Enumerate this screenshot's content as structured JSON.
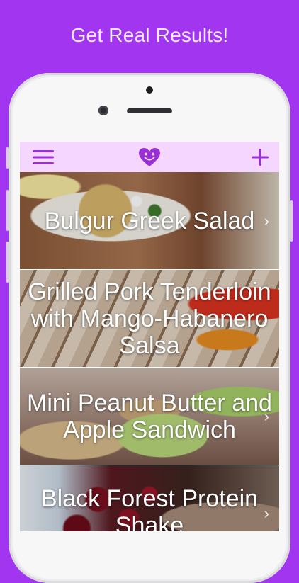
{
  "tagline": "Get Real Results!",
  "navbar": {
    "menu_icon": "hamburger-menu-icon",
    "logo_icon": "smiling-heart-icon",
    "add_icon": "plus-icon",
    "accent_color": "#9b2fd6"
  },
  "recipes": [
    {
      "title": "Bulgur Greek Salad",
      "chevron": "›"
    },
    {
      "title": "Grilled Pork Tenderloin with Mango-Habanero Salsa",
      "chevron": ""
    },
    {
      "title": "Mini Peanut Butter and Apple Sandwich",
      "chevron": "›"
    },
    {
      "title": "Black Forest Protein Shake",
      "chevron": "›"
    }
  ],
  "colors": {
    "background": "#a235f0",
    "navbar": "#f5d6ff",
    "accent": "#9b2fd6"
  }
}
